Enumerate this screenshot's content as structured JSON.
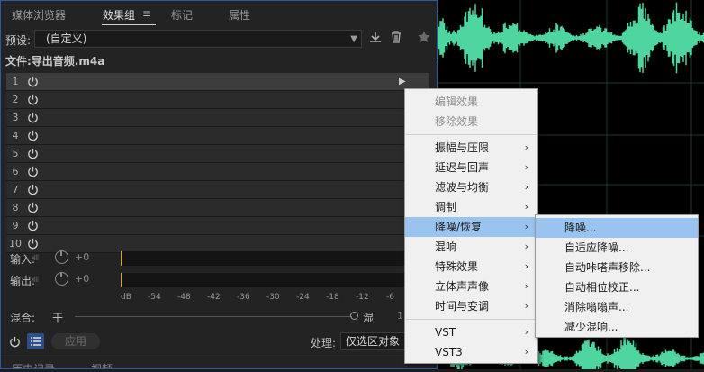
{
  "tabs": [
    {
      "label": "媒体浏览器"
    },
    {
      "label": "效果组",
      "menu_glyph": "≡"
    },
    {
      "label": "标记"
    },
    {
      "label": "属性"
    }
  ],
  "preset": {
    "label": "预设:",
    "value": "(自定义)"
  },
  "file": {
    "label": "文件:导出音频.m4a"
  },
  "slots": [
    "1",
    "2",
    "3",
    "4",
    "5",
    "6",
    "7",
    "8",
    "9",
    "10"
  ],
  "input": {
    "label": "输入:",
    "value": "+0"
  },
  "output": {
    "label": "输出:",
    "value": "+0"
  },
  "db_scale": [
    "dB",
    "-54",
    "-48",
    "-42",
    "-36",
    "-30",
    "-24",
    "-18",
    "-12",
    "-6"
  ],
  "mix": {
    "label": "混合:",
    "dry": "干",
    "wet": "湿",
    "value": "1"
  },
  "apply_label": "应用",
  "process": {
    "label": "处理:",
    "value": "仅选区对象"
  },
  "lower_tabs": [
    "历史记录",
    "视频"
  ],
  "context_menu": {
    "items": [
      {
        "label": "编辑效果",
        "disabled": true
      },
      {
        "label": "移除效果",
        "disabled": true
      },
      {
        "label": "振幅与压限"
      },
      {
        "label": "延迟与回声"
      },
      {
        "label": "滤波与均衡"
      },
      {
        "label": "调制"
      },
      {
        "label": "降噪/恢复",
        "highlighted": true
      },
      {
        "label": "混响"
      },
      {
        "label": "特殊效果"
      },
      {
        "label": "立体声声像"
      },
      {
        "label": "时间与变调"
      },
      {
        "label": "VST"
      },
      {
        "label": "VST3"
      }
    ]
  },
  "submenu": {
    "items": [
      {
        "label": "降噪...",
        "highlighted": true
      },
      {
        "label": "自适应降噪..."
      },
      {
        "label": "自动咔嗒声移除..."
      },
      {
        "label": "自动相位校正..."
      },
      {
        "label": "消除嗡嗡声..."
      },
      {
        "label": "减少混响..."
      }
    ]
  },
  "colors": {
    "waveform": "#4fd6a0",
    "highlight": "#99c4f0",
    "accent": "#2b5aa8"
  }
}
